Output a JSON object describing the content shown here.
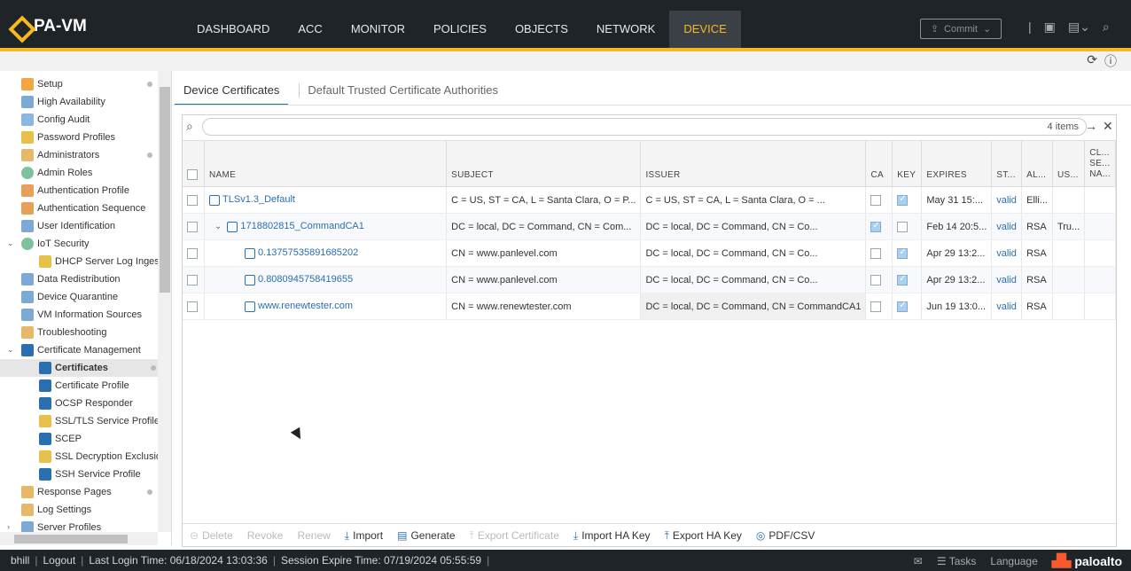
{
  "app": {
    "logo_text": "PA-VM",
    "nav": [
      "DASHBOARD",
      "ACC",
      "MONITOR",
      "POLICIES",
      "OBJECTS",
      "NETWORK",
      "DEVICE"
    ],
    "active_nav": "DEVICE",
    "commit_label": "Commit"
  },
  "sidebar": {
    "items": [
      {
        "label": "Setup",
        "icon": "gear-icon",
        "dot": true
      },
      {
        "label": "High Availability",
        "icon": "ha-icon",
        "dot": false
      },
      {
        "label": "Config Audit",
        "icon": "audit-icon",
        "dot": false
      },
      {
        "label": "Password Profiles",
        "icon": "key-icon",
        "dot": false
      },
      {
        "label": "Administrators",
        "icon": "user-icon",
        "dot": true
      },
      {
        "label": "Admin Roles",
        "icon": "role-icon",
        "dot": false
      },
      {
        "label": "Authentication Profile",
        "icon": "auth-icon",
        "dot": false
      },
      {
        "label": "Authentication Sequence",
        "icon": "auth-seq-icon",
        "dot": false
      },
      {
        "label": "User Identification",
        "icon": "user-id-icon",
        "dot": false
      },
      {
        "label": "IoT Security",
        "icon": "iot-icon",
        "dot": false
      },
      {
        "label": "DHCP Server Log Inges",
        "icon": "dhcp-icon",
        "dot": false
      },
      {
        "label": "Data Redistribution",
        "icon": "data-icon",
        "dot": false
      },
      {
        "label": "Device Quarantine",
        "icon": "quarantine-icon",
        "dot": false
      },
      {
        "label": "VM Information Sources",
        "icon": "vm-icon",
        "dot": false
      },
      {
        "label": "Troubleshooting",
        "icon": "wrench-icon",
        "dot": false
      },
      {
        "label": "Certificate Management",
        "icon": "cert-mgmt-icon",
        "dot": false
      },
      {
        "label": "Certificates",
        "icon": "certificate-icon",
        "dot": true
      },
      {
        "label": "Certificate Profile",
        "icon": "cert-profile-icon",
        "dot": false
      },
      {
        "label": "OCSP Responder",
        "icon": "ocsp-icon",
        "dot": false
      },
      {
        "label": "SSL/TLS Service Profile",
        "icon": "lock-icon",
        "dot": false
      },
      {
        "label": "SCEP",
        "icon": "scep-icon",
        "dot": false
      },
      {
        "label": "SSL Decryption Exclusio",
        "icon": "lock-icon",
        "dot": false
      },
      {
        "label": "SSH Service Profile",
        "icon": "ssh-icon",
        "dot": false
      },
      {
        "label": "Response Pages",
        "icon": "page-icon",
        "dot": true
      },
      {
        "label": "Log Settings",
        "icon": "log-icon",
        "dot": false
      },
      {
        "label": "Server Profiles",
        "icon": "server-icon",
        "dot": false
      }
    ]
  },
  "main": {
    "tabs": [
      "Device Certificates",
      "Default Trusted Certificate Authorities"
    ],
    "items_count": "4 items",
    "columns": [
      "NAME",
      "SUBJECT",
      "ISSUER",
      "CA",
      "KEY",
      "EXPIRES",
      "ST...",
      "AL...",
      "US...",
      "CL... SE... NA..."
    ],
    "rows": [
      {
        "name": "TLSv1.3_Default",
        "subject": "C = US, ST = CA, L = Santa Clara, O = P...",
        "issuer": "C = US, ST = CA, L = Santa Clara, O = ...",
        "ca": false,
        "key": true,
        "expires": "May 31 15:...",
        "status": "valid",
        "algorithm": "Elli...",
        "usage": ""
      },
      {
        "name": "1718802815_CommandCA1",
        "subject": "DC = local, DC = Command, CN = Com...",
        "issuer": "DC = local, DC = Command, CN = Co...",
        "ca": true,
        "key": false,
        "expires": "Feb 14 20:5...",
        "status": "valid",
        "algorithm": "RSA",
        "usage": "Tru..."
      },
      {
        "name": "0.13757535891685202",
        "subject": "CN = www.panlevel.com",
        "issuer": "DC = local, DC = Command, CN = Co...",
        "ca": false,
        "key": true,
        "expires": "Apr 29 13:2...",
        "status": "valid",
        "algorithm": "RSA",
        "usage": ""
      },
      {
        "name": "0.8080945758419655",
        "subject": "CN = www.panlevel.com",
        "issuer": "DC = local, DC = Command, CN = Co...",
        "ca": false,
        "key": true,
        "expires": "Apr 29 13:2...",
        "status": "valid",
        "algorithm": "RSA",
        "usage": ""
      },
      {
        "name": "www.renewtester.com",
        "subject": "CN = www.renewtester.com",
        "issuer": "DC = local, DC = Command, CN = CommandCA1",
        "ca": false,
        "key": true,
        "expires": "Jun 19 13:0...",
        "status": "valid",
        "algorithm": "RSA",
        "usage": ""
      }
    ],
    "toolbar": {
      "delete": "Delete",
      "revoke": "Revoke",
      "renew": "Renew",
      "import": "Import",
      "generate": "Generate",
      "export_certificate": "Export Certificate",
      "import_ha_key": "Import HA Key",
      "export_ha_key": "Export HA Key",
      "pdf_csv": "PDF/CSV"
    }
  },
  "footer": {
    "user": "bhill",
    "logout": "Logout",
    "last_login": "Last Login Time: 06/18/2024 13:03:36",
    "session_expire": "Session Expire Time: 07/19/2024 05:55:59",
    "tasks": "Tasks",
    "language": "Language",
    "brand": "paloalto"
  }
}
